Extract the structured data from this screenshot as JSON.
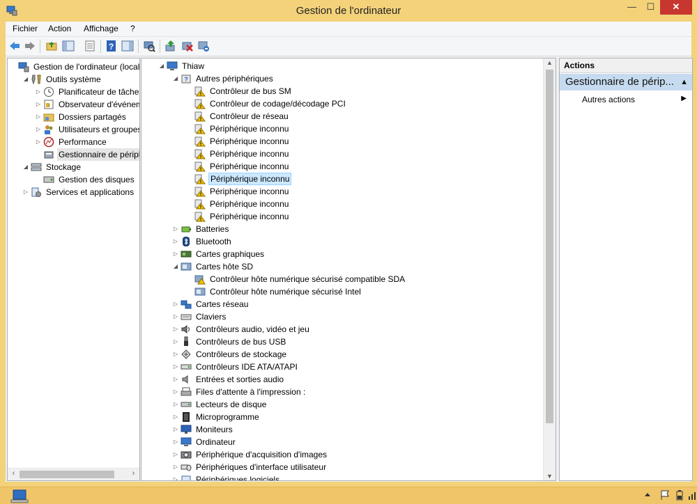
{
  "window": {
    "title": "Gestion de l'ordinateur",
    "min_label": "—",
    "max_label": "☐",
    "close_label": "✕"
  },
  "menu": [
    "Fichier",
    "Action",
    "Affichage",
    "?"
  ],
  "toolbar_icons": [
    "back-arrow-icon",
    "forward-arrow-icon",
    "up-folder-icon",
    "show-hide-tree-icon",
    "properties-icon",
    "help-icon",
    "show-hide-action-pane-icon",
    "scan-hardware-icon",
    "update-driver-icon",
    "disable-device-icon",
    "uninstall-device-icon"
  ],
  "left_tree": [
    {
      "label": "Gestion de l'ordinateur (local)",
      "level": 0,
      "expander": "",
      "icon": "computer-management-icon"
    },
    {
      "label": "Outils système",
      "level": 1,
      "expander": "◢",
      "icon": "tools-icon"
    },
    {
      "label": "Planificateur de tâches",
      "level": 2,
      "expander": "▷",
      "icon": "clock-icon"
    },
    {
      "label": "Observateur d'événeme",
      "level": 2,
      "expander": "▷",
      "icon": "event-viewer-icon"
    },
    {
      "label": "Dossiers partagés",
      "level": 2,
      "expander": "▷",
      "icon": "shared-folder-icon"
    },
    {
      "label": "Utilisateurs et groupes l",
      "level": 2,
      "expander": "▷",
      "icon": "users-icon"
    },
    {
      "label": "Performance",
      "level": 2,
      "expander": "▷",
      "icon": "performance-icon"
    },
    {
      "label": "Gestionnaire de périphé",
      "level": 2,
      "expander": "",
      "icon": "device-manager-icon",
      "selected": true
    },
    {
      "label": "Stockage",
      "level": 1,
      "expander": "◢",
      "icon": "storage-icon"
    },
    {
      "label": "Gestion des disques",
      "level": 2,
      "expander": "",
      "icon": "disk-icon"
    },
    {
      "label": "Services et applications",
      "level": 1,
      "expander": "▷",
      "icon": "services-icon"
    }
  ],
  "device_tree": [
    {
      "label": "Thiaw",
      "level": 0,
      "expander": "◢",
      "icon": "computer-icon"
    },
    {
      "label": "Autres périphériques",
      "level": 1,
      "expander": "◢",
      "icon": "unknown-device-icon"
    },
    {
      "label": "Contrôleur de bus SM",
      "level": 2,
      "expander": "",
      "icon": "warning-device-icon"
    },
    {
      "label": "Contrôleur de codage/décodage PCI",
      "level": 2,
      "expander": "",
      "icon": "warning-device-icon"
    },
    {
      "label": "Contrôleur de réseau",
      "level": 2,
      "expander": "",
      "icon": "warning-device-icon"
    },
    {
      "label": "Périphérique inconnu",
      "level": 2,
      "expander": "",
      "icon": "warning-device-icon"
    },
    {
      "label": "Périphérique inconnu",
      "level": 2,
      "expander": "",
      "icon": "warning-device-icon"
    },
    {
      "label": "Périphérique inconnu",
      "level": 2,
      "expander": "",
      "icon": "warning-device-icon"
    },
    {
      "label": "Périphérique inconnu",
      "level": 2,
      "expander": "",
      "icon": "warning-device-icon"
    },
    {
      "label": "Périphérique inconnu",
      "level": 2,
      "expander": "",
      "icon": "warning-device-icon",
      "selected": true
    },
    {
      "label": "Périphérique inconnu",
      "level": 2,
      "expander": "",
      "icon": "warning-device-icon"
    },
    {
      "label": "Périphérique inconnu",
      "level": 2,
      "expander": "",
      "icon": "warning-device-icon"
    },
    {
      "label": "Périphérique inconnu",
      "level": 2,
      "expander": "",
      "icon": "warning-device-icon"
    },
    {
      "label": "Batteries",
      "level": 1,
      "expander": "▷",
      "icon": "battery-icon"
    },
    {
      "label": "Bluetooth",
      "level": 1,
      "expander": "▷",
      "icon": "bluetooth-icon"
    },
    {
      "label": "Cartes graphiques",
      "level": 1,
      "expander": "▷",
      "icon": "display-adapter-icon"
    },
    {
      "label": "Cartes hôte SD",
      "level": 1,
      "expander": "◢",
      "icon": "sd-host-icon"
    },
    {
      "label": "Contrôleur hôte numérique sécurisé compatible SDA",
      "level": 2,
      "expander": "",
      "icon": "sd-warning-icon"
    },
    {
      "label": "Contrôleur hôte numérique sécurisé Intel",
      "level": 2,
      "expander": "",
      "icon": "sd-host-icon"
    },
    {
      "label": "Cartes réseau",
      "level": 1,
      "expander": "▷",
      "icon": "network-adapter-icon"
    },
    {
      "label": "Claviers",
      "level": 1,
      "expander": "▷",
      "icon": "keyboard-icon"
    },
    {
      "label": "Contrôleurs audio, vidéo et jeu",
      "level": 1,
      "expander": "▷",
      "icon": "speaker-icon"
    },
    {
      "label": "Contrôleurs de bus USB",
      "level": 1,
      "expander": "▷",
      "icon": "usb-icon"
    },
    {
      "label": "Contrôleurs de stockage",
      "level": 1,
      "expander": "▷",
      "icon": "storage-controller-icon"
    },
    {
      "label": "Contrôleurs IDE ATA/ATAPI",
      "level": 1,
      "expander": "▷",
      "icon": "ide-icon"
    },
    {
      "label": "Entrées et sorties audio",
      "level": 1,
      "expander": "▷",
      "icon": "audio-io-icon"
    },
    {
      "label": "Files d'attente à l'impression :",
      "level": 1,
      "expander": "▷",
      "icon": "print-queue-icon"
    },
    {
      "label": "Lecteurs de disque",
      "level": 1,
      "expander": "▷",
      "icon": "disk-drive-icon"
    },
    {
      "label": "Microprogramme",
      "level": 1,
      "expander": "▷",
      "icon": "firmware-icon"
    },
    {
      "label": "Moniteurs",
      "level": 1,
      "expander": "▷",
      "icon": "monitor-icon"
    },
    {
      "label": "Ordinateur",
      "level": 1,
      "expander": "▷",
      "icon": "computer-icon"
    },
    {
      "label": "Périphérique d'acquisition d'images",
      "level": 1,
      "expander": "▷",
      "icon": "camera-icon"
    },
    {
      "label": "Périphériques d'interface utilisateur",
      "level": 1,
      "expander": "▷",
      "icon": "hid-icon"
    },
    {
      "label": "Périphériques logiciels",
      "level": 1,
      "expander": "▷",
      "icon": "software-device-icon"
    }
  ],
  "actions": {
    "header": "Actions",
    "section": "Gestionnaire de périp...",
    "more": "Autres actions"
  },
  "colors": {
    "title_bar": "#f3d27a",
    "close_button": "#c7372f",
    "selection": "#cce8ff",
    "action_section": "#c6dbef",
    "warning": "#f2c200"
  }
}
